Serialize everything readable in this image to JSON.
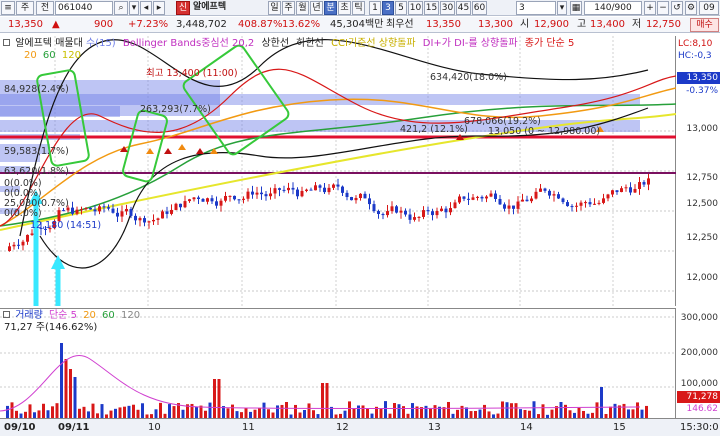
{
  "toolbar": {
    "market_prefix": "주",
    "view_label": "전",
    "stock_code": "061040",
    "search_icon": "search-icon",
    "mode_badge": "신",
    "stock_name": "알에프텍",
    "period_buttons": [
      "일",
      "주",
      "월",
      "년",
      "분",
      "초",
      "틱"
    ],
    "minute_buttons": [
      "1",
      "3",
      "5",
      "10",
      "15",
      "30",
      "45",
      "60"
    ],
    "minute_value": "3",
    "count_value": "140/900",
    "order_button": "매수"
  },
  "quote": {
    "price": "13,350",
    "change_arrow": "▲",
    "change": "900",
    "change_pct": "+7.23%",
    "volume": "3,448,702",
    "volume_ratio": "408.87%",
    "turnover": "13.62%",
    "amount": "45,304백만",
    "best_ask_label": "최우선",
    "best_ask": "13,350",
    "best_bid": "13,300",
    "open_label": "시",
    "open": "12,900",
    "high_label": "고",
    "high": "13,400",
    "low_label": "저",
    "low": "12,750"
  },
  "price_pane": {
    "legend": {
      "name": "알에프텍",
      "chart_kind": "매물대",
      "vol_profile": "수(15)",
      "bollinger": "Bollinger Bands중심선 20,2",
      "upper": "상한선",
      "lower": "하한선",
      "cci": "CCI기준선 상향돌파",
      "di": "DI+가 DI-를 상향돌파",
      "ma_title": "종가 단순 5",
      "ma_periods": [
        "20",
        "60",
        "120"
      ]
    },
    "right_corner": [
      "LC:8,10",
      "HC:-0,3"
    ],
    "annotations": {
      "high_marker": "최고 13,400 (11:00)",
      "profile_label_top": "634,420(18.0%)",
      "profile_label_1": "84,928(2.4%)",
      "profile_label_2": "263,293(7.7%)",
      "profile_label_3": "678,066(19.2%)",
      "profile_label_4": "421,2 (12.1%)",
      "range_label": "13,050 (0 ~ 12,980.00)",
      "profile_label_5": "59,583(1.7%)",
      "profile_label_6": "63,620(1.8%)",
      "zero_pct_1": "0(0.0%)",
      "zero_pct_2": "0(0.0%)",
      "profile_label_7": "25,030(0.7%)",
      "zero_pct_3": "0(0.0%)",
      "low_marker": "12,180 (14:51)"
    },
    "y_ticks": [
      "13,000",
      "12,750",
      "12,500",
      "12,250",
      "12,000"
    ],
    "price_tag": "13,350",
    "change_tag": "-0.37%"
  },
  "volume_pane": {
    "legend_name": "거래량",
    "legend_ma": [
      "단순 5",
      "20",
      "60",
      "120"
    ],
    "last_value": "71,27 주(146.62%)",
    "y_ticks": [
      "300,000",
      "200,000",
      "100,000"
    ],
    "volume_tag": "71,278",
    "ratio_tag": "146.62"
  },
  "x_axis": {
    "labels": [
      "09/10",
      "09/11",
      "10",
      "11",
      "12",
      "13",
      "14",
      "15"
    ],
    "time_label": "15:30:0"
  },
  "colors": {
    "up": "#d81818",
    "down": "#1c3ac8",
    "ma5": "#d81818",
    "ma20": "#f29a12",
    "ma60": "#27a03a",
    "ma120": "#e6e62c",
    "profile": "#6e7ee6",
    "annotation_green": "#36c93a",
    "arrow_cyan": "#38e8ff"
  }
}
